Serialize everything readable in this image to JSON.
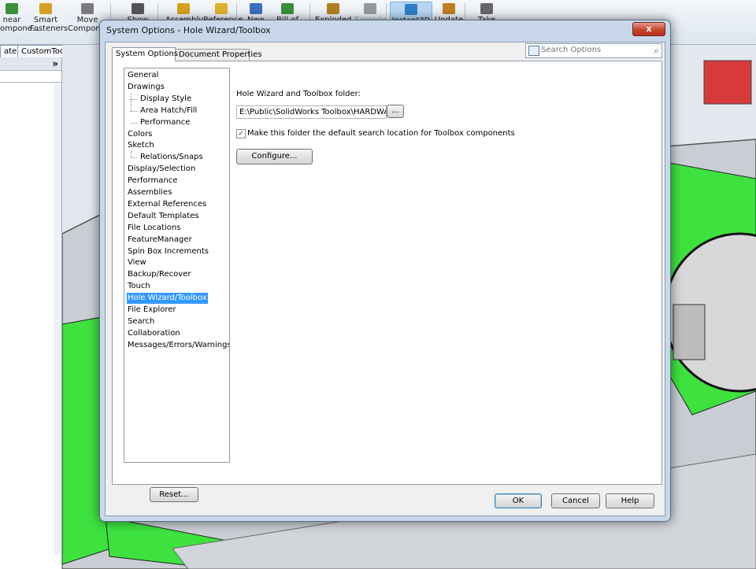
{
  "ribbon": {
    "items": [
      {
        "label": "near\nompone...",
        "icon": "linear-pattern-icon"
      },
      {
        "label": "Smart\nFasteners",
        "icon": "smart-fasteners-icon"
      },
      {
        "label": "Move\nCompone...",
        "icon": "move-component-icon"
      },
      {
        "label": "Show",
        "icon": "show-hidden-icon"
      },
      {
        "label": "Assembly",
        "icon": "assembly-features-icon"
      },
      {
        "label": "Reference",
        "icon": "reference-geometry-icon"
      },
      {
        "label": "New",
        "icon": "new-motion-study-icon"
      },
      {
        "label": "Bill of",
        "icon": "bill-of-materials-icon"
      },
      {
        "label": "Exploded",
        "icon": "exploded-view-icon"
      },
      {
        "label": "Explode",
        "icon": "explode-line-sketch-icon"
      },
      {
        "label": "Instant3D",
        "icon": "instant3d-icon"
      },
      {
        "label": "Update",
        "icon": "update-icon"
      },
      {
        "label": "Take",
        "icon": "take-snapshot-icon"
      }
    ]
  },
  "command_tabs": [
    "ate",
    "CustomTools"
  ],
  "dialog": {
    "title": "System Options - Hole Wizard/Toolbox",
    "close_label": "x",
    "tabs": [
      "System Options",
      "Document Properties"
    ],
    "search": {
      "placeholder": "Search Options"
    },
    "tree": [
      {
        "label": "General",
        "level": 0
      },
      {
        "label": "Drawings",
        "level": 0
      },
      {
        "label": "Display Style",
        "level": 1
      },
      {
        "label": "Area Hatch/Fill",
        "level": 1
      },
      {
        "label": "Performance",
        "level": 1
      },
      {
        "label": "Colors",
        "level": 0
      },
      {
        "label": "Sketch",
        "level": 0
      },
      {
        "label": "Relations/Snaps",
        "level": 1
      },
      {
        "label": "Display/Selection",
        "level": 0
      },
      {
        "label": "Performance",
        "level": 0
      },
      {
        "label": "Assemblies",
        "level": 0
      },
      {
        "label": "External References",
        "level": 0
      },
      {
        "label": "Default Templates",
        "level": 0
      },
      {
        "label": "File Locations",
        "level": 0
      },
      {
        "label": "FeatureManager",
        "level": 0
      },
      {
        "label": "Spin Box Increments",
        "level": 0
      },
      {
        "label": "View",
        "level": 0
      },
      {
        "label": "Backup/Recover",
        "level": 0
      },
      {
        "label": "Touch",
        "level": 0
      },
      {
        "label": "Hole Wizard/Toolbox",
        "level": 0,
        "selected": true
      },
      {
        "label": "File Explorer",
        "level": 0
      },
      {
        "label": "Search",
        "level": 0
      },
      {
        "label": "Collaboration",
        "level": 0
      },
      {
        "label": "Messages/Errors/Warnings",
        "level": 0
      }
    ],
    "folder_label": "Hole Wizard and Toolbox folder:",
    "folder_path": "E:\\Public\\SolidWorks Toolbox\\HARDWARE\\",
    "browse_label": "...",
    "default_search_checkbox": {
      "label": "Make this folder the default search location for Toolbox components",
      "checked": true,
      "mark": "✓"
    },
    "configure_label": "Configure...",
    "reset_label": "Reset...",
    "ok_label": "OK",
    "cancel_label": "Cancel",
    "help_label": "Help"
  }
}
